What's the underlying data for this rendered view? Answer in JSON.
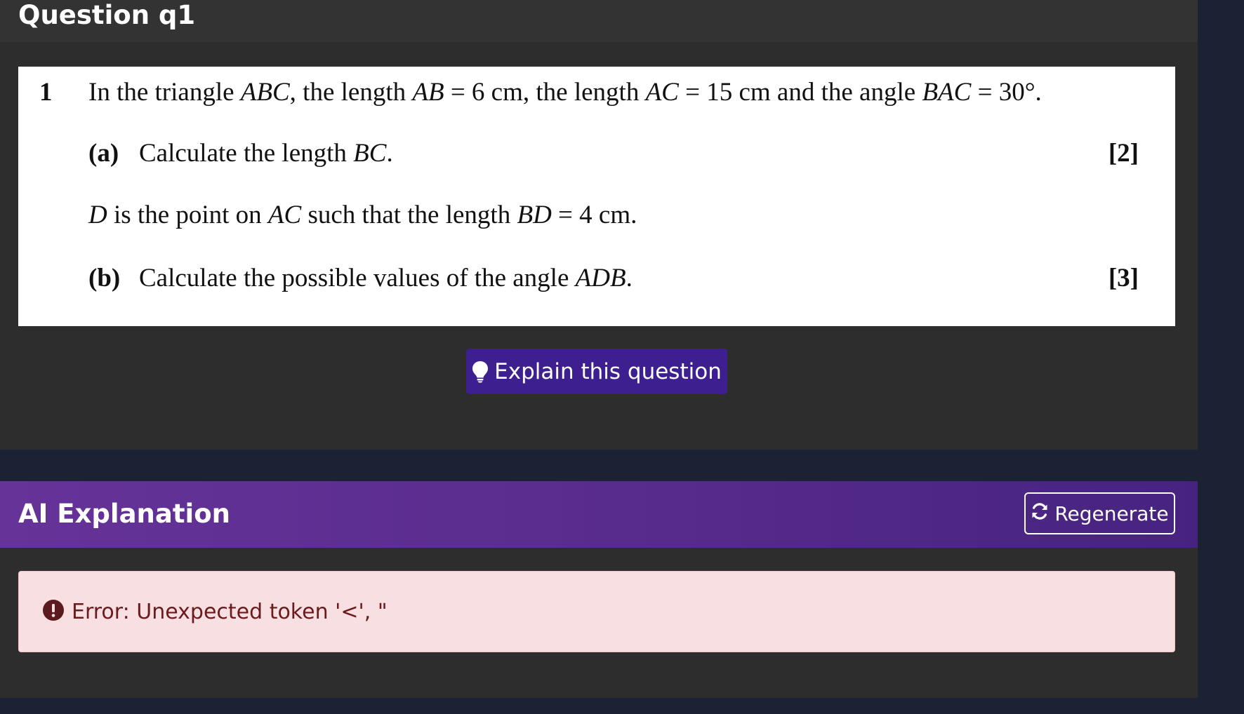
{
  "question": {
    "title": "Question q1",
    "number": "1",
    "stem": [
      {
        "t": "In the triangle "
      },
      {
        "t": "ABC",
        "i": true
      },
      {
        "t": ", the length "
      },
      {
        "t": "AB",
        "i": true
      },
      {
        "t": " = 6 cm, the length "
      },
      {
        "t": "AC",
        "i": true
      },
      {
        "t": " = 15 cm and the angle "
      },
      {
        "t": "BAC",
        "i": true
      },
      {
        "t": " = 30°."
      }
    ],
    "part_a": {
      "label": "(a)",
      "text": [
        {
          "t": "Calculate the length "
        },
        {
          "t": "BC",
          "i": true
        },
        {
          "t": "."
        }
      ],
      "marks": "[2]"
    },
    "d_line": [
      {
        "t": "D",
        "i": true
      },
      {
        "t": " is the point on "
      },
      {
        "t": "AC",
        "i": true
      },
      {
        "t": " such that the length "
      },
      {
        "t": "BD",
        "i": true
      },
      {
        "t": " = 4 cm."
      }
    ],
    "part_b": {
      "label": "(b)",
      "text": [
        {
          "t": "Calculate the possible values of the angle "
        },
        {
          "t": "ADB",
          "i": true
        },
        {
          "t": "."
        }
      ],
      "marks": "[3]"
    },
    "explain_button": {
      "label": "Explain this question",
      "icon": "lightbulb-icon"
    }
  },
  "explanation": {
    "title": "AI Explanation",
    "regenerate_button": {
      "label": "Regenerate",
      "icon": "refresh-icon"
    },
    "error": {
      "icon": "exclamation-circle-icon",
      "message": "Error: Unexpected token '<', \""
    }
  },
  "colors": {
    "panel_bg": "#2d2d2d",
    "page_bg": "#1b2233",
    "explain_button": "#3d1f8f",
    "header_gradient_start": "#663399",
    "header_gradient_end": "#47237f",
    "error_bg": "#f8dfe1",
    "error_text": "#6b1a1e"
  }
}
